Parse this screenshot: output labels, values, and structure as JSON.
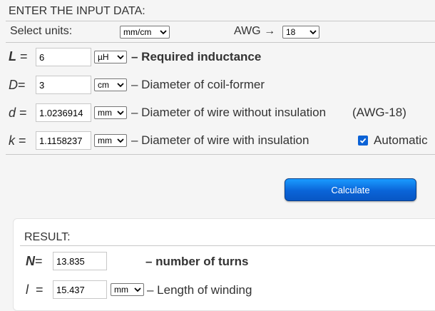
{
  "input": {
    "title": "ENTER THE INPUT DATA:",
    "units_label": "Select units:",
    "units_value": "mm/cm",
    "awg_label": "AWG →",
    "awg_value": "18",
    "rows": [
      {
        "symbol": "L",
        "eq": "=",
        "value": "6",
        "unit": "µH",
        "desc": "– Required inductance"
      },
      {
        "symbol": "D",
        "eq": "=",
        "value": "3",
        "unit": "cm",
        "desc": "– Diameter of coil-former"
      },
      {
        "symbol": "d",
        "eq": "=",
        "value": "1.0236914",
        "unit": "mm",
        "desc": "– Diameter of wire without insulation",
        "note": "(AWG-18)"
      },
      {
        "symbol": "k",
        "eq": "=",
        "value": "1.1158237",
        "unit": "mm",
        "desc": "– Diameter of wire with insulation",
        "checkbox_label": "Automatic",
        "checkbox_checked": true
      }
    ]
  },
  "calculate_label": "Calculate",
  "result": {
    "title": "RESULT:",
    "rows": [
      {
        "symbol": "N",
        "eq": "=",
        "value": "13.835",
        "desc": "– number of turns"
      },
      {
        "symbol": "l",
        "eq": "=",
        "value": "15.437",
        "unit": "mm",
        "desc": "– Length of winding"
      }
    ]
  },
  "colors": {
    "accent": "#0b62d6",
    "button_top": "#1a9bff",
    "button_bottom": "#0857c4"
  }
}
